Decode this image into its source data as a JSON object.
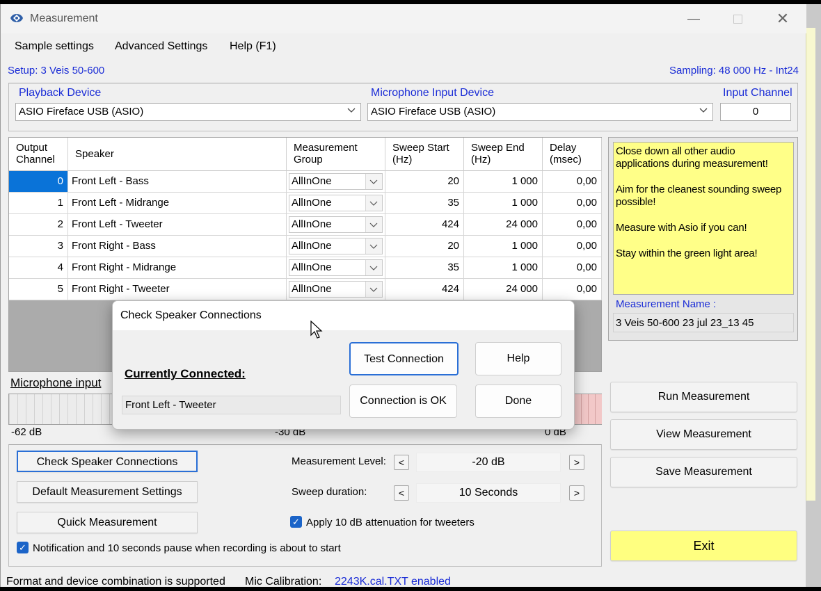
{
  "window": {
    "title": "Measurement"
  },
  "menu": [
    "Sample settings",
    "Advanced Settings",
    "Help (F1)"
  ],
  "setup_label": "Setup: 3 Veis 50-600",
  "sampling_label": "Sampling: 48 000 Hz - Int24",
  "playback": {
    "label": "Playback Device",
    "value": "ASIO Fireface USB (ASIO)"
  },
  "microphone": {
    "label": "Microphone Input Device",
    "value": "ASIO Fireface USB (ASIO)"
  },
  "input_channel": {
    "label": "Input Channel",
    "value": "0"
  },
  "table": {
    "headers": [
      "Output\nChannel",
      "Speaker",
      "Measurement\nGroup",
      "Sweep Start\n(Hz)",
      "Sweep End\n(Hz)",
      "Delay\n(msec)"
    ],
    "rows": [
      {
        "channel": "0",
        "speaker": "Front Left - Bass",
        "group": "AllInOne",
        "start": "20",
        "end": "1 000",
        "delay": "0,00"
      },
      {
        "channel": "1",
        "speaker": "Front Left - Midrange",
        "group": "AllInOne",
        "start": "35",
        "end": "1 000",
        "delay": "0,00"
      },
      {
        "channel": "2",
        "speaker": "Front Left - Tweeter",
        "group": "AllInOne",
        "start": "424",
        "end": "24 000",
        "delay": "0,00"
      },
      {
        "channel": "3",
        "speaker": "Front Right - Bass",
        "group": "AllInOne",
        "start": "20",
        "end": "1 000",
        "delay": "0,00"
      },
      {
        "channel": "4",
        "speaker": "Front Right - Midrange",
        "group": "AllInOne",
        "start": "35",
        "end": "1 000",
        "delay": "0,00"
      },
      {
        "channel": "5",
        "speaker": "Front Right - Tweeter",
        "group": "AllInOne",
        "start": "424",
        "end": "24 000",
        "delay": "0,00"
      }
    ]
  },
  "tips": [
    "Close down all other audio applications during measurement!",
    "Aim for the cleanest sounding sweep possible!",
    "Measure with Asio if you can!",
    "Stay within the green light area!"
  ],
  "measurement_name": {
    "label": "Measurement Name :",
    "value": "3 Veis 50-600 23 jul 23_13 45"
  },
  "mic_input": {
    "label": "Microphone input",
    "scale_min": "-62 dB",
    "scale_mid": "-30 dB",
    "scale_max": "0 dB"
  },
  "buttons": {
    "check_speaker": "Check Speaker Connections",
    "default_settings": "Default Measurement Settings",
    "quick": "Quick Measurement",
    "run": "Run Measurement",
    "view": "View Measurement",
    "save": "Save Measurement",
    "exit": "Exit"
  },
  "measurement_level": {
    "label": "Measurement Level:",
    "value": "-20 dB"
  },
  "sweep_duration": {
    "label": "Sweep duration:",
    "value": "10 Seconds"
  },
  "attenuation": {
    "label": "Apply 10 dB attenuation for tweeters",
    "checked": true
  },
  "notification": {
    "label": "Notification and 10 seconds pause when recording is about to start",
    "checked": true
  },
  "status": {
    "text": "Format and device combination is supported",
    "calib_label": "Mic Calibration:",
    "calib_value": "2243K.cal.TXT enabled"
  },
  "dialog": {
    "title": "Check Speaker Connections",
    "connected_label": "Currently Connected:",
    "connected_value": "Front Left - Tweeter",
    "test_button": "Test Connection",
    "help_button": "Help",
    "ok_button": "Connection is OK",
    "done_button": "Done"
  },
  "colors": {
    "accent_blue": "#1a2cd6",
    "tips_bg": "#ffff88",
    "exit_bg": "#ffff80",
    "selection": "#0a73d8"
  }
}
